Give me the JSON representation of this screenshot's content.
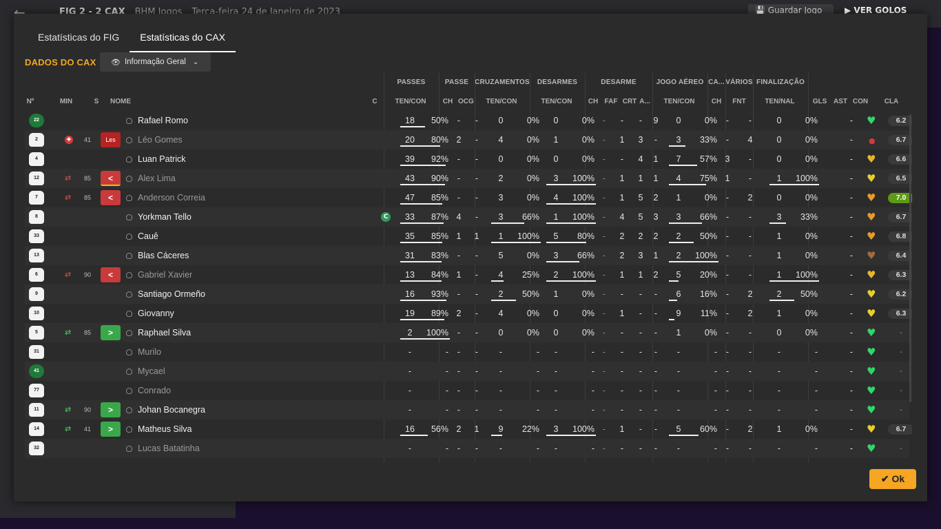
{
  "background": {
    "match_title": "FIG  2 - 2  CAX",
    "club": "BHM Jogos",
    "date": "Terça-feira 24 de Janeiro de 2023",
    "save_label": "Guardar Jogo",
    "goals_label": "VER GOLOS"
  },
  "tabs": [
    {
      "label": "Estatísticas do FIG",
      "active": false
    },
    {
      "label": "Estatísticas do CAX",
      "active": true
    }
  ],
  "section_title": "DADOS DO CAX",
  "view_dropdown": {
    "selected": "Informação Geral"
  },
  "group_headers": [
    "PASSES",
    "PASSE",
    "CRUZAMENTOS",
    "DESARMES",
    "DESARME",
    "JOGO AÉREO",
    "CA...",
    "VÁRIOS",
    "FINALIZAÇÃO"
  ],
  "columns": {
    "num": "Nº",
    "min": "MIN",
    "s": "S",
    "name": "NOME",
    "c": "C",
    "passes": "TEN/CON",
    "passe_ch": "CH",
    "passe_ocg": "OCG",
    "cross": "TEN/CON",
    "tackles": "TEN/CON",
    "des_ch": "CH",
    "des_faf": "FAF",
    "des_crt": "CRT",
    "des_a": "A...",
    "aerial": "TEN/CON",
    "ca_ch": "CH",
    "var_fnt": "FNT",
    "fin": "TEN/NAL",
    "gls": "GLS",
    "ast": "AST",
    "con": "CON",
    "cla": "CLA"
  },
  "colors": {
    "accent": "#f5a623",
    "green": "#3aa84a",
    "red": "#c93a3a",
    "best_rating": "#5e9a15"
  },
  "players": [
    {
      "num": "22",
      "gk": true,
      "min": "",
      "min_icon": "",
      "s": "",
      "s_type": "",
      "name": "Rafael Romo",
      "cap": false,
      "sub": false,
      "pas_t": "18",
      "pas_p": "50%",
      "pas_f": 0.5,
      "ch": "-",
      "ocg": "-",
      "cr_t": "0",
      "cr_p": "0%",
      "cr_f": 0,
      "tk_t": "0",
      "tk_p": "0%",
      "tk_f": 0,
      "d_ch": "-",
      "d_faf": "-",
      "d_crt": "-",
      "d_a": "9",
      "ae_t": "0",
      "ae_p": "0%",
      "ae_f": 0,
      "ca": "-",
      "fnt": "-",
      "fi_t": "0",
      "fi_p": "0%",
      "fi_f": 0,
      "gls": "",
      "ast": "-",
      "con": "green",
      "cla": "6.2",
      "best": false
    },
    {
      "num": "2",
      "gk": false,
      "min": "41",
      "min_icon": "inj",
      "s": "Les",
      "s_type": "les",
      "name": "Léo Gomes",
      "cap": false,
      "sub": true,
      "pas_t": "20",
      "pas_p": "80%",
      "pas_f": 0.8,
      "ch": "2",
      "ocg": "-",
      "cr_t": "4",
      "cr_p": "0%",
      "cr_f": 0,
      "tk_t": "1",
      "tk_p": "0%",
      "tk_f": 0,
      "d_ch": "-",
      "d_faf": "1",
      "d_crt": "3",
      "d_a": "-",
      "ae_t": "3",
      "ae_p": "33%",
      "ae_f": 0.33,
      "ca": "-",
      "fnt": "4",
      "fi_t": "0",
      "fi_p": "0%",
      "fi_f": 0,
      "gls": "",
      "ast": "-",
      "con": "injury",
      "cla": "6.7",
      "best": false
    },
    {
      "num": "4",
      "gk": false,
      "min": "",
      "min_icon": "",
      "s": "",
      "s_type": "",
      "name": "Luan Patrick",
      "cap": false,
      "sub": false,
      "pas_t": "39",
      "pas_p": "92%",
      "pas_f": 0.92,
      "ch": "-",
      "ocg": "-",
      "cr_t": "0",
      "cr_p": "0%",
      "cr_f": 0,
      "tk_t": "0",
      "tk_p": "0%",
      "tk_f": 0,
      "d_ch": "-",
      "d_faf": "-",
      "d_crt": "4",
      "d_a": "1",
      "ae_t": "7",
      "ae_p": "57%",
      "ae_f": 0.57,
      "ca": "3",
      "fnt": "-",
      "fi_t": "0",
      "fi_p": "0%",
      "fi_f": 0,
      "gls": "",
      "ast": "-",
      "con": "yellow-orange",
      "cla": "6.6",
      "best": false
    },
    {
      "num": "12",
      "gk": false,
      "min": "85",
      "min_icon": "out",
      "s": "<",
      "s_type": "redyel",
      "name": "Alex Lima",
      "cap": false,
      "sub": true,
      "pas_t": "43",
      "pas_p": "90%",
      "pas_f": 0.9,
      "ch": "-",
      "ocg": "-",
      "cr_t": "2",
      "cr_p": "0%",
      "cr_f": 0,
      "tk_t": "3",
      "tk_p": "100%",
      "tk_f": 1,
      "d_ch": "-",
      "d_faf": "1",
      "d_crt": "1",
      "d_a": "1",
      "ae_t": "4",
      "ae_p": "75%",
      "ae_f": 0.75,
      "ca": "1",
      "fnt": "-",
      "fi_t": "1",
      "fi_p": "100%",
      "fi_f": 1,
      "gls": "",
      "ast": "-",
      "con": "yellow",
      "cla": "6.5",
      "best": false
    },
    {
      "num": "7",
      "gk": false,
      "min": "85",
      "min_icon": "out",
      "s": "<",
      "s_type": "red",
      "name": "Anderson Correia",
      "cap": false,
      "sub": true,
      "pas_t": "47",
      "pas_p": "85%",
      "pas_f": 0.85,
      "ch": "-",
      "ocg": "-",
      "cr_t": "3",
      "cr_p": "0%",
      "cr_f": 0,
      "tk_t": "4",
      "tk_p": "100%",
      "tk_f": 1,
      "d_ch": "-",
      "d_faf": "1",
      "d_crt": "5",
      "d_a": "2",
      "ae_t": "1",
      "ae_p": "0%",
      "ae_f": 0,
      "ca": "-",
      "fnt": "2",
      "fi_t": "0",
      "fi_p": "0%",
      "fi_f": 0,
      "gls": "",
      "ast": "-",
      "con": "orange",
      "cla": "7.0",
      "best": true
    },
    {
      "num": "8",
      "gk": false,
      "min": "",
      "min_icon": "",
      "s": "",
      "s_type": "",
      "name": "Yorkman Tello",
      "cap": true,
      "sub": false,
      "pas_t": "33",
      "pas_p": "87%",
      "pas_f": 0.87,
      "ch": "4",
      "ocg": "-",
      "cr_t": "3",
      "cr_p": "66%",
      "cr_f": 0.66,
      "tk_t": "1",
      "tk_p": "100%",
      "tk_f": 1,
      "d_ch": "-",
      "d_faf": "4",
      "d_crt": "5",
      "d_a": "3",
      "ae_t": "3",
      "ae_p": "66%",
      "ae_f": 0.66,
      "ca": "-",
      "fnt": "-",
      "fi_t": "3",
      "fi_p": "33%",
      "fi_f": 0.33,
      "gls": "",
      "ast": "-",
      "con": "orange",
      "cla": "6.7",
      "best": false
    },
    {
      "num": "33",
      "gk": false,
      "min": "",
      "min_icon": "",
      "s": "",
      "s_type": "",
      "name": "Cauê",
      "cap": false,
      "sub": false,
      "pas_t": "35",
      "pas_p": "85%",
      "pas_f": 0.85,
      "ch": "1",
      "ocg": "1",
      "cr_t": "1",
      "cr_p": "100%",
      "cr_f": 1,
      "tk_t": "5",
      "tk_p": "80%",
      "tk_f": 0.8,
      "d_ch": "-",
      "d_faf": "2",
      "d_crt": "2",
      "d_a": "2",
      "ae_t": "2",
      "ae_p": "50%",
      "ae_f": 0.5,
      "ca": "-",
      "fnt": "-",
      "fi_t": "1",
      "fi_p": "0%",
      "fi_f": 0,
      "gls": "",
      "ast": "-",
      "con": "orange",
      "cla": "6.8",
      "best": false
    },
    {
      "num": "13",
      "gk": false,
      "min": "",
      "min_icon": "",
      "s": "",
      "s_type": "",
      "name": "Blas Cáceres",
      "cap": false,
      "sub": false,
      "pas_t": "31",
      "pas_p": "83%",
      "pas_f": 0.83,
      "ch": "-",
      "ocg": "-",
      "cr_t": "5",
      "cr_p": "0%",
      "cr_f": 0,
      "tk_t": "3",
      "tk_p": "66%",
      "tk_f": 0.66,
      "d_ch": "-",
      "d_faf": "2",
      "d_crt": "3",
      "d_a": "1",
      "ae_t": "2",
      "ae_p": "100%",
      "ae_f": 1,
      "ca": "-",
      "fnt": "-",
      "fi_t": "1",
      "fi_p": "0%",
      "fi_f": 0,
      "gls": "",
      "ast": "-",
      "con": "brown",
      "cla": "6.4",
      "best": false
    },
    {
      "num": "6",
      "gk": false,
      "min": "90",
      "min_icon": "out",
      "s": "<",
      "s_type": "red",
      "name": "Gabriel Xavier",
      "cap": false,
      "sub": true,
      "pas_t": "13",
      "pas_p": "84%",
      "pas_f": 0.84,
      "ch": "1",
      "ocg": "-",
      "cr_t": "4",
      "cr_p": "25%",
      "cr_f": 0.25,
      "tk_t": "2",
      "tk_p": "100%",
      "tk_f": 1,
      "d_ch": "-",
      "d_faf": "1",
      "d_crt": "1",
      "d_a": "2",
      "ae_t": "5",
      "ae_p": "20%",
      "ae_f": 0.2,
      "ca": "-",
      "fnt": "-",
      "fi_t": "1",
      "fi_p": "100%",
      "fi_f": 1,
      "gls": "",
      "ast": "-",
      "con": "yellow-orange",
      "cla": "6.3",
      "best": false
    },
    {
      "num": "9",
      "gk": false,
      "min": "",
      "min_icon": "",
      "s": "",
      "s_type": "",
      "name": "Santiago Ormeño",
      "cap": false,
      "sub": false,
      "pas_t": "16",
      "pas_p": "93%",
      "pas_f": 0.93,
      "ch": "-",
      "ocg": "-",
      "cr_t": "2",
      "cr_p": "50%",
      "cr_f": 0.5,
      "tk_t": "1",
      "tk_p": "0%",
      "tk_f": 0,
      "d_ch": "-",
      "d_faf": "-",
      "d_crt": "-",
      "d_a": "-",
      "ae_t": "6",
      "ae_p": "16%",
      "ae_f": 0.16,
      "ca": "-",
      "fnt": "2",
      "fi_t": "2",
      "fi_p": "50%",
      "fi_f": 0.5,
      "gls": "",
      "ast": "-",
      "con": "yellow",
      "cla": "6.2",
      "best": false
    },
    {
      "num": "10",
      "gk": false,
      "min": "",
      "min_icon": "",
      "s": "",
      "s_type": "",
      "name": "Giovanny",
      "cap": false,
      "sub": false,
      "pas_t": "19",
      "pas_p": "89%",
      "pas_f": 0.89,
      "ch": "2",
      "ocg": "-",
      "cr_t": "4",
      "cr_p": "0%",
      "cr_f": 0,
      "tk_t": "0",
      "tk_p": "0%",
      "tk_f": 0,
      "d_ch": "-",
      "d_faf": "1",
      "d_crt": "-",
      "d_a": "-",
      "ae_t": "9",
      "ae_p": "11%",
      "ae_f": 0.11,
      "ca": "-",
      "fnt": "2",
      "fi_t": "1",
      "fi_p": "0%",
      "fi_f": 0,
      "gls": "",
      "ast": "-",
      "con": "yellow",
      "cla": "6.3",
      "best": false
    },
    {
      "num": "5",
      "gk": false,
      "min": "85",
      "min_icon": "in",
      "s": ">",
      "s_type": "green",
      "name": "Raphael Silva",
      "cap": false,
      "sub": false,
      "pas_t": "2",
      "pas_p": "100%",
      "pas_f": 1,
      "ch": "-",
      "ocg": "-",
      "cr_t": "0",
      "cr_p": "0%",
      "cr_f": 0,
      "tk_t": "0",
      "tk_p": "0%",
      "tk_f": 0,
      "d_ch": "-",
      "d_faf": "-",
      "d_crt": "-",
      "d_a": "-",
      "ae_t": "1",
      "ae_p": "0%",
      "ae_f": 0,
      "ca": "-",
      "fnt": "-",
      "fi_t": "0",
      "fi_p": "0%",
      "fi_f": 0,
      "gls": "",
      "ast": "-",
      "con": "green",
      "cla": "-",
      "best": false
    },
    {
      "num": "31",
      "gk": false,
      "min": "",
      "min_icon": "",
      "s": "",
      "s_type": "",
      "name": "Murilo",
      "cap": false,
      "sub": true,
      "pas_t": "-",
      "pas_p": "-",
      "pas_f": 0,
      "ch": "-",
      "ocg": "-",
      "cr_t": "-",
      "cr_p": "-",
      "cr_f": 0,
      "tk_t": "-",
      "tk_p": "-",
      "tk_f": 0,
      "d_ch": "-",
      "d_faf": "-",
      "d_crt": "-",
      "d_a": "-",
      "ae_t": "-",
      "ae_p": "-",
      "ae_f": 0,
      "ca": "-",
      "fnt": "-",
      "fi_t": "-",
      "fi_p": "-",
      "fi_f": 0,
      "gls": "",
      "ast": "-",
      "con": "green",
      "cla": "-",
      "best": false
    },
    {
      "num": "41",
      "gk": true,
      "min": "",
      "min_icon": "",
      "s": "",
      "s_type": "",
      "name": "Mycael",
      "cap": false,
      "sub": true,
      "pas_t": "-",
      "pas_p": "-",
      "pas_f": 0,
      "ch": "-",
      "ocg": "-",
      "cr_t": "-",
      "cr_p": "-",
      "cr_f": 0,
      "tk_t": "-",
      "tk_p": "-",
      "tk_f": 0,
      "d_ch": "-",
      "d_faf": "-",
      "d_crt": "-",
      "d_a": "-",
      "ae_t": "-",
      "ae_p": "-",
      "ae_f": 0,
      "ca": "-",
      "fnt": "-",
      "fi_t": "-",
      "fi_p": "-",
      "fi_f": 0,
      "gls": "",
      "ast": "-",
      "con": "green",
      "cla": "-",
      "best": false
    },
    {
      "num": "77",
      "gk": false,
      "min": "",
      "min_icon": "",
      "s": "",
      "s_type": "",
      "name": "Conrado",
      "cap": false,
      "sub": true,
      "pas_t": "-",
      "pas_p": "-",
      "pas_f": 0,
      "ch": "-",
      "ocg": "-",
      "cr_t": "-",
      "cr_p": "-",
      "cr_f": 0,
      "tk_t": "-",
      "tk_p": "-",
      "tk_f": 0,
      "d_ch": "-",
      "d_faf": "-",
      "d_crt": "-",
      "d_a": "-",
      "ae_t": "-",
      "ae_p": "-",
      "ae_f": 0,
      "ca": "-",
      "fnt": "-",
      "fi_t": "-",
      "fi_p": "-",
      "fi_f": 0,
      "gls": "",
      "ast": "-",
      "con": "green",
      "cla": "-",
      "best": false
    },
    {
      "num": "11",
      "gk": false,
      "min": "90",
      "min_icon": "in",
      "s": ">",
      "s_type": "green",
      "name": "Johan Bocanegra",
      "cap": false,
      "sub": false,
      "pas_t": "-",
      "pas_p": "-",
      "pas_f": 0,
      "ch": "-",
      "ocg": "-",
      "cr_t": "-",
      "cr_p": "-",
      "cr_f": 0,
      "tk_t": "-",
      "tk_p": "-",
      "tk_f": 0,
      "d_ch": "-",
      "d_faf": "-",
      "d_crt": "-",
      "d_a": "-",
      "ae_t": "-",
      "ae_p": "-",
      "ae_f": 0,
      "ca": "-",
      "fnt": "-",
      "fi_t": "-",
      "fi_p": "-",
      "fi_f": 0,
      "gls": "",
      "ast": "-",
      "con": "green",
      "cla": "-",
      "best": false
    },
    {
      "num": "14",
      "gk": false,
      "min": "41",
      "min_icon": "in",
      "s": ">",
      "s_type": "green",
      "name": "Matheus Silva",
      "cap": false,
      "sub": false,
      "pas_t": "16",
      "pas_p": "56%",
      "pas_f": 0.56,
      "ch": "2",
      "ocg": "1",
      "cr_t": "9",
      "cr_p": "22%",
      "cr_f": 0.22,
      "tk_t": "3",
      "tk_p": "100%",
      "tk_f": 1,
      "d_ch": "-",
      "d_faf": "1",
      "d_crt": "-",
      "d_a": "-",
      "ae_t": "5",
      "ae_p": "60%",
      "ae_f": 0.6,
      "ca": "-",
      "fnt": "2",
      "fi_t": "1",
      "fi_p": "0%",
      "fi_f": 0,
      "gls": "",
      "ast": "-",
      "con": "yellow",
      "cla": "6.7",
      "best": false
    },
    {
      "num": "32",
      "gk": false,
      "min": "",
      "min_icon": "",
      "s": "",
      "s_type": "",
      "name": "Lucas Batatinha",
      "cap": false,
      "sub": true,
      "pas_t": "-",
      "pas_p": "-",
      "pas_f": 0,
      "ch": "-",
      "ocg": "-",
      "cr_t": "-",
      "cr_p": "-",
      "cr_f": 0,
      "tk_t": "-",
      "tk_p": "-",
      "tk_f": 0,
      "d_ch": "-",
      "d_faf": "-",
      "d_crt": "-",
      "d_a": "-",
      "ae_t": "-",
      "ae_p": "-",
      "ae_f": 0,
      "ca": "-",
      "fnt": "-",
      "fi_t": "-",
      "fi_p": "-",
      "fi_f": 0,
      "gls": "",
      "ast": "-",
      "con": "green",
      "cla": "-",
      "best": false
    }
  ],
  "ok_label": "Ok"
}
